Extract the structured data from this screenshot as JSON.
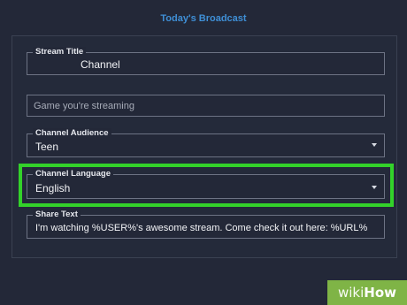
{
  "header": {
    "title": "Today's Broadcast"
  },
  "form": {
    "stream_title": {
      "label": "Stream Title",
      "value": "Channel"
    },
    "game": {
      "placeholder": "Game you're streaming"
    },
    "audience": {
      "label": "Channel Audience",
      "value": "Teen"
    },
    "language": {
      "label": "Channel Language",
      "value": "English"
    },
    "share_text": {
      "label": "Share Text",
      "value": "I'm watching %USER%'s awesome stream. Come check it out here: %URL%"
    }
  },
  "watermark": {
    "part1": "wiki",
    "part2": "How"
  },
  "colors": {
    "background": "#232838",
    "accent": "#3f8fd6",
    "highlight": "#33d22a",
    "watermark": "#7fb446"
  },
  "icons": {
    "dropdown": "chevron-down-icon"
  }
}
